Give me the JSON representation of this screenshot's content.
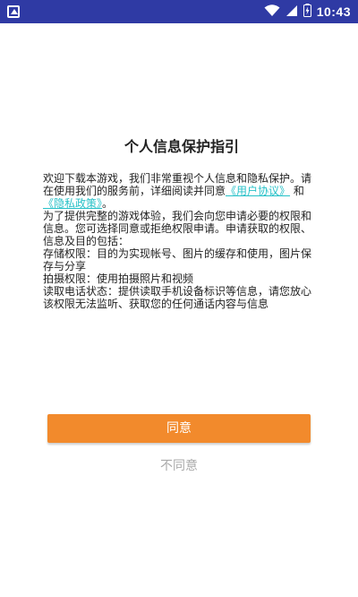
{
  "status_bar": {
    "time": "10:43",
    "icons": [
      "app-notification-icon",
      "wifi-icon",
      "signal-icon",
      "battery-icon"
    ],
    "background_color": "#2f3aa4"
  },
  "dialog": {
    "title": "个人信息保护指引",
    "intro_prefix": "欢迎下载本游戏，我们非常重视个人信息和隐私保护。请在使用我们的服务前，详细阅读并同意",
    "user_agreement_link": "《用户协议》",
    "and_text": "和",
    "privacy_policy_link": "《隐私政策》",
    "intro_suffix": "。",
    "paragraphs": [
      "为了提供完整的游戏体验，我们会向您申请必要的权限和信息。您可选择同意或拒绝权限申请。申请获取的权限、信息及目的包括：",
      "存储权限：目的为实现帐号、图片的缓存和使用，图片保存与分享",
      "拍摄权限：使用拍摄照片和视频",
      "读取电话状态：提供读取手机设备标识等信息，请您放心该权限无法监听、获取您的任何通话内容与信息"
    ],
    "link_color": "#27c1c8"
  },
  "buttons": {
    "agree_label": "同意",
    "decline_label": "不同意",
    "agree_color": "#f28a2c"
  }
}
